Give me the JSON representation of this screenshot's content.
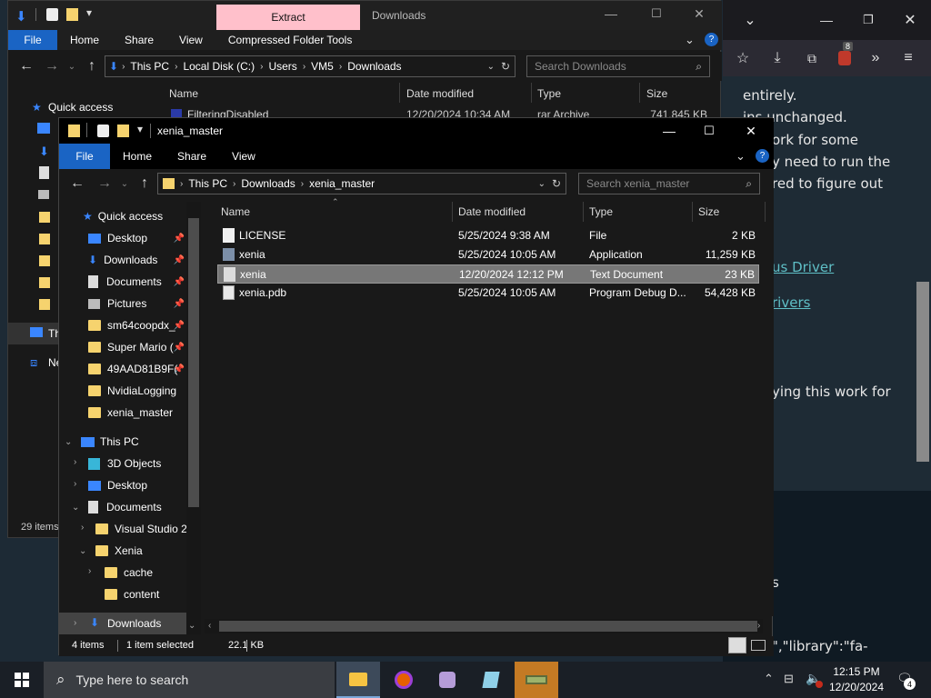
{
  "browser": {
    "notification_count": "8",
    "lines": [
      {
        "text": "entirely.",
        "link": false
      },
      {
        "text": "ins unchanged.",
        "link": false
      },
      {
        "text": "ork for some",
        "link": false
      },
      {
        "text": "y need to run the",
        "link": false
      },
      {
        "text": "red to figure out",
        "link": false
      },
      {
        "text": "us Driver",
        "link": true
      },
      {
        "text": "rivers",
        "link": true
      },
      {
        "text": "ying this work for",
        "link": false
      },
      {
        "text": "s",
        "link": false
      },
      {
        "text": "\",\"library\":\"fa-",
        "link": false
      }
    ]
  },
  "back_window": {
    "extract_tab": "Extract",
    "title": "Downloads",
    "ribbon_tabs": [
      "File",
      "Home",
      "Share",
      "View",
      "Compressed Folder Tools"
    ],
    "breadcrumbs": [
      "This PC",
      "Local Disk (C:)",
      "Users",
      "VM5",
      "Downloads"
    ],
    "search_placeholder": "Search Downloads",
    "columns": [
      "Name",
      "Date modified",
      "Type",
      "Size"
    ],
    "first_row": {
      "name": "FilteringDisabled",
      "date": "12/20/2024 10:34 AM",
      "type": "rar Archive",
      "size": "741,845 KB"
    },
    "quick_access": "Quick access",
    "nav_this_pc": "Th",
    "nav_network": "Ne",
    "status": "29 items"
  },
  "front_window": {
    "title": "xenia_master",
    "ribbon_tabs": [
      "File",
      "Home",
      "Share",
      "View"
    ],
    "breadcrumbs": [
      "This PC",
      "Downloads",
      "xenia_master"
    ],
    "search_placeholder": "Search xenia_master",
    "columns": [
      "Name",
      "Date modified",
      "Type",
      "Size"
    ],
    "files": [
      {
        "name": "LICENSE",
        "date": "5/25/2024 9:38 AM",
        "type": "File",
        "size": "2 KB"
      },
      {
        "name": "xenia",
        "date": "5/25/2024 10:05 AM",
        "type": "Application",
        "size": "11,259 KB"
      },
      {
        "name": "xenia",
        "date": "12/20/2024 12:12 PM",
        "type": "Text Document",
        "size": "23 KB"
      },
      {
        "name": "xenia.pdb",
        "date": "5/25/2024 10:05 AM",
        "type": "Program Debug D...",
        "size": "54,428 KB"
      }
    ],
    "nav": {
      "quick_access": "Quick access",
      "qa_items": [
        "Desktop",
        "Downloads",
        "Documents",
        "Pictures",
        "sm64coopdx_",
        "Super Mario (",
        "49AAD81B9F(",
        "NvidiaLogging",
        "xenia_master"
      ],
      "this_pc": "This PC",
      "pc_items": [
        "3D Objects",
        "Desktop",
        "Documents"
      ],
      "doc_items": [
        "Visual Studio 2",
        "Xenia"
      ],
      "xenia_items": [
        "cache",
        "content"
      ],
      "downloads": "Downloads"
    },
    "status": {
      "items": "4 items",
      "selected": "1 item selected",
      "size": "22.1 KB"
    }
  },
  "taskbar": {
    "search_placeholder": "Type here to search",
    "time": "12:15 PM",
    "date": "12/20/2024",
    "notifications": "4"
  },
  "colors": {
    "accent": "#1a64c4",
    "folder": "#f6d36e",
    "extract_tab": "#ffc0cb",
    "link": "#5fbfc6"
  }
}
